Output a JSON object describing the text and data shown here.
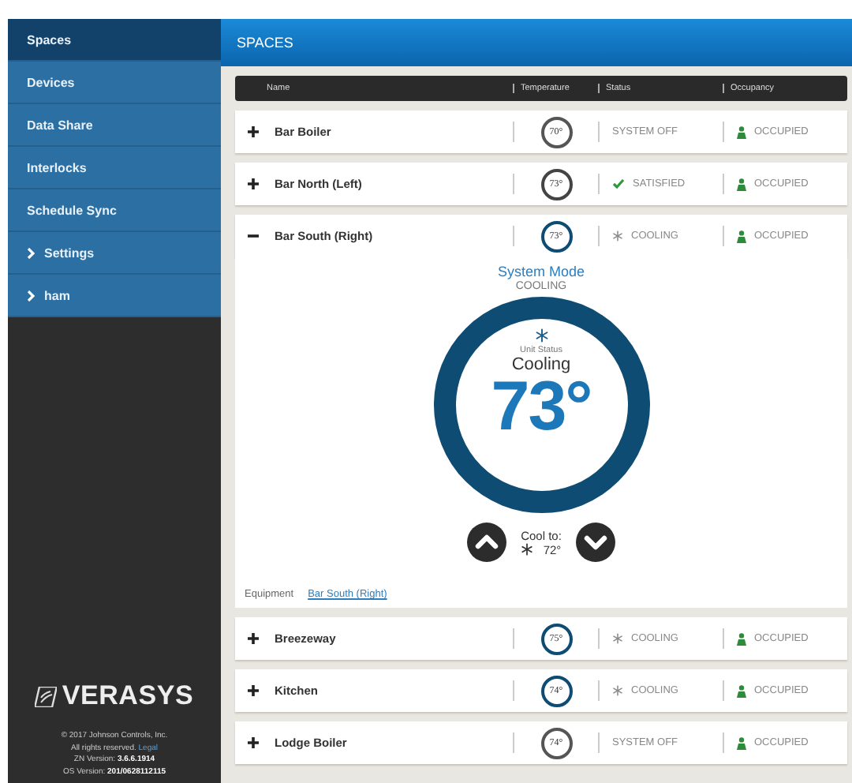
{
  "sidebar": {
    "items": [
      {
        "label": "Spaces",
        "selected": true,
        "kind": "link"
      },
      {
        "label": "Devices",
        "selected": false,
        "kind": "link"
      },
      {
        "label": "Data Share",
        "selected": false,
        "kind": "link"
      },
      {
        "label": "Interlocks",
        "selected": false,
        "kind": "link"
      },
      {
        "label": "Schedule Sync",
        "selected": false,
        "kind": "link"
      },
      {
        "label": "Settings",
        "selected": false,
        "kind": "group"
      },
      {
        "label": "ham",
        "selected": false,
        "kind": "group"
      }
    ],
    "logo": "VERASYS",
    "footer": {
      "copyright": "© 2017 Johnson Controls, Inc.",
      "rights": "All rights reserved.",
      "legal_link": "Legal",
      "zn_label": "ZN Version:",
      "zn_version": "3.6.6.1914",
      "os_label": "OS Version:",
      "os_version": "201/0628112115"
    }
  },
  "header": {
    "title": "SPACES"
  },
  "table": {
    "columns": [
      "Name",
      "Temperature",
      "Status",
      "Occupancy"
    ],
    "rows": [
      {
        "name": "Bar Boiler",
        "temperature": "70°",
        "status": "SYSTEM OFF",
        "kind": "off",
        "occupancy": "OCCUPIED",
        "expanded": false
      },
      {
        "name": "Bar North (Left)",
        "temperature": "73°",
        "status": "SATISFIED",
        "kind": "satisfied",
        "occupancy": "OCCUPIED",
        "expanded": false
      },
      {
        "name": "Bar South (Right)",
        "temperature": "73°",
        "status": "COOLING",
        "kind": "cooling",
        "occupancy": "OCCUPIED",
        "expanded": true,
        "detail": {
          "mode_label": "System Mode",
          "mode": "COOLING",
          "unit_status_label": "Unit Status",
          "unit_status": "Cooling",
          "temperature": "73°",
          "setpoint_label": "Cool to:",
          "setpoint": "72°",
          "equipment_label": "Equipment",
          "equipment_link": "Bar South (Right)"
        }
      },
      {
        "name": "Breezeway",
        "temperature": "75°",
        "status": "COOLING",
        "kind": "cooling",
        "occupancy": "OCCUPIED",
        "expanded": false
      },
      {
        "name": "Kitchen",
        "temperature": "74°",
        "status": "COOLING",
        "kind": "cooling",
        "occupancy": "OCCUPIED",
        "expanded": false
      },
      {
        "name": "Lodge Boiler",
        "temperature": "74°",
        "status": "SYSTEM OFF",
        "kind": "off",
        "occupancy": "OCCUPIED",
        "expanded": false
      }
    ]
  }
}
